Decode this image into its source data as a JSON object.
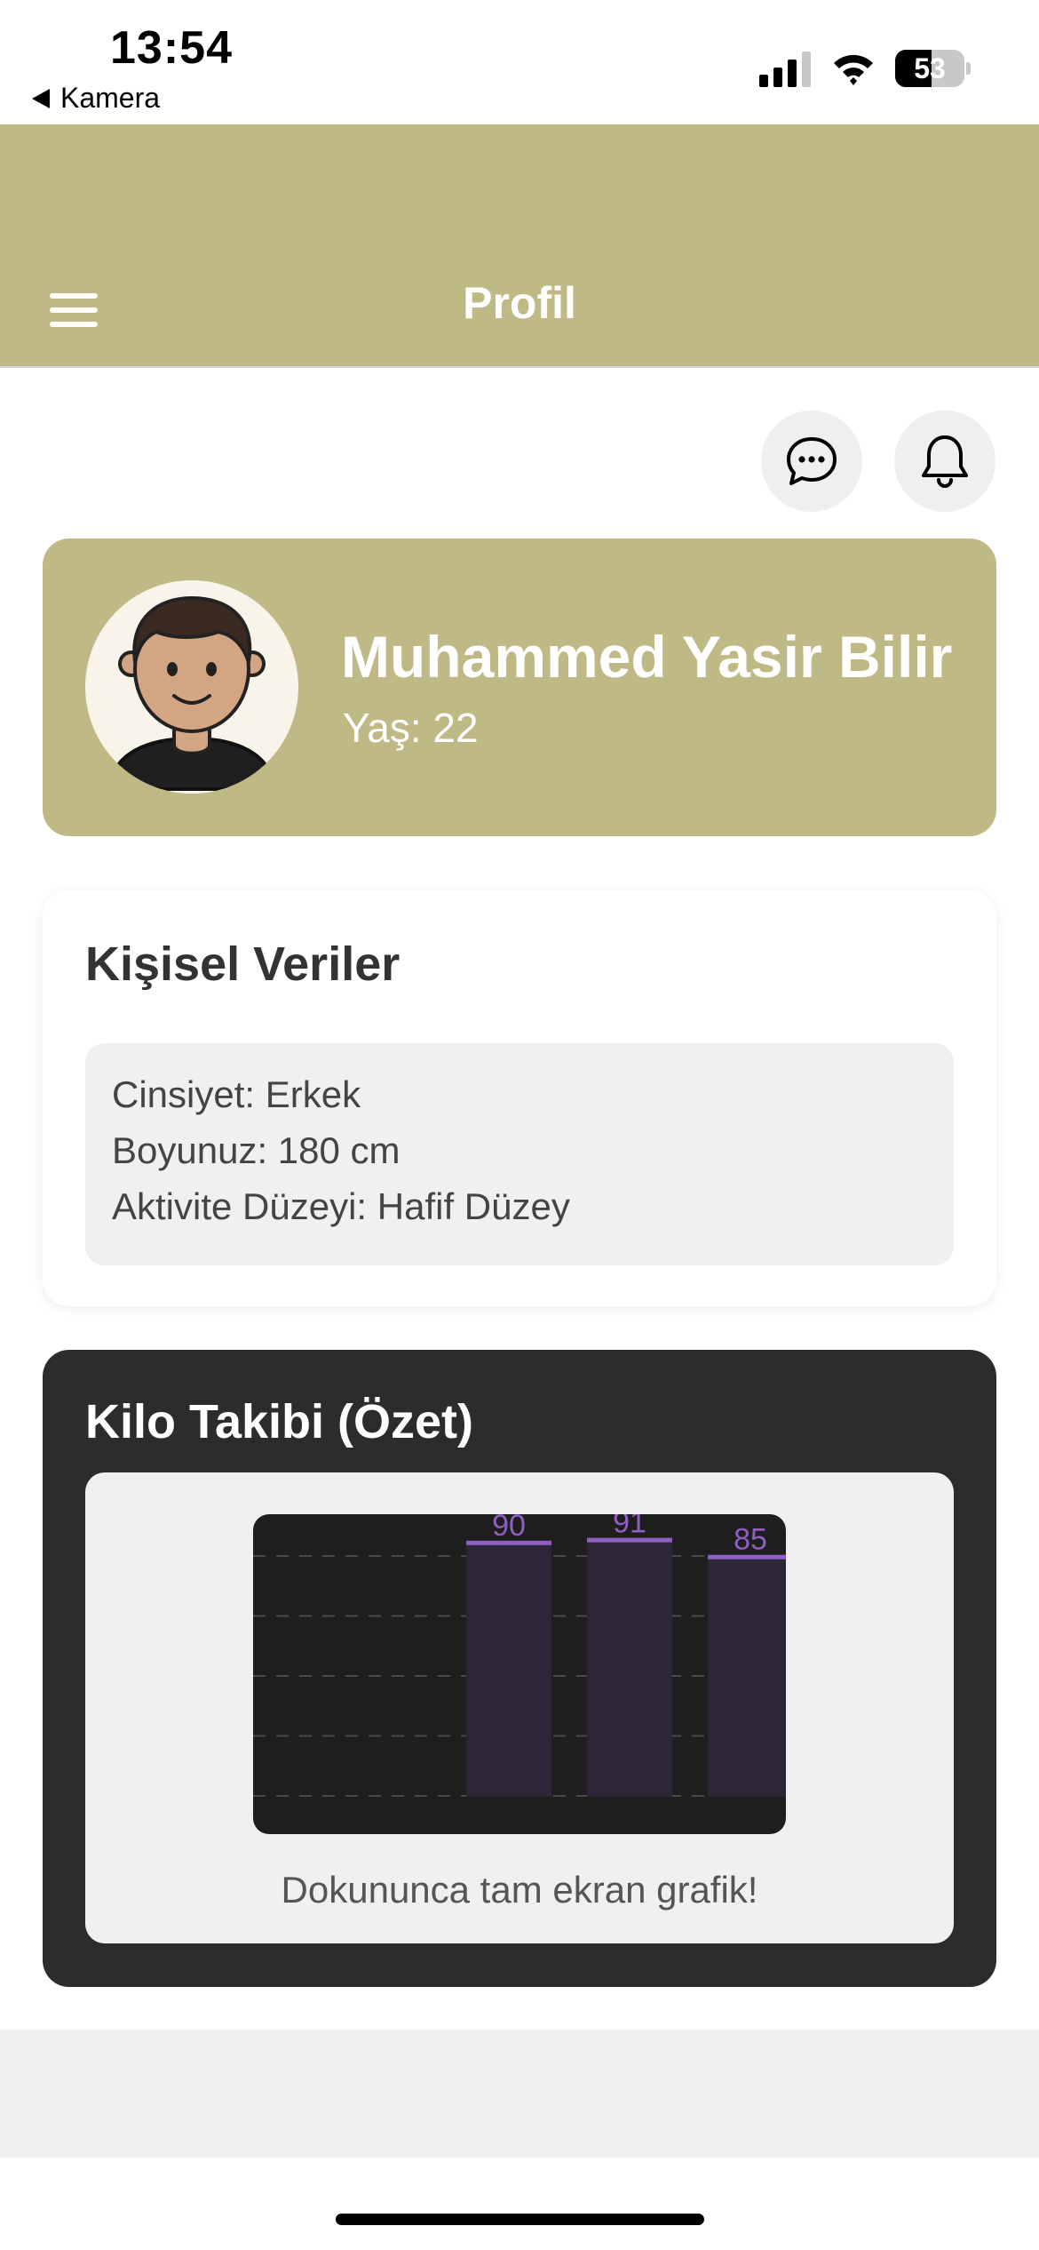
{
  "status_bar": {
    "time": "13:54",
    "back_label": "Kamera",
    "battery_level": "53",
    "battery_fraction": 0.53
  },
  "header": {
    "title": "Profil",
    "color": "#bfb986"
  },
  "actions": {
    "chat_icon": "chat-bubble-icon",
    "bell_icon": "bell-icon"
  },
  "profile": {
    "name": "Muhammed Yasir Bilir",
    "age_text": "Yaş: 22"
  },
  "personal": {
    "title": "Kişisel Veriler",
    "gender": "Cinsiyet: Erkek",
    "height": "Boyunuz: 180 cm",
    "activity": "Aktivite Düzeyi: Hafif Düzey"
  },
  "weight": {
    "title": "Kilo Takibi (Özet)",
    "caption": "Dokununca tam ekran grafik!"
  },
  "chart_data": {
    "type": "bar",
    "categories": [
      "",
      "",
      ""
    ],
    "values": [
      90,
      91,
      85
    ],
    "data_labels": [
      "90",
      "91",
      "85"
    ],
    "ylim": [
      0,
      100
    ],
    "grid": true,
    "bar_color": "#2f2538",
    "line_color": "#8e5fc0",
    "background": "#1e1e1e"
  }
}
